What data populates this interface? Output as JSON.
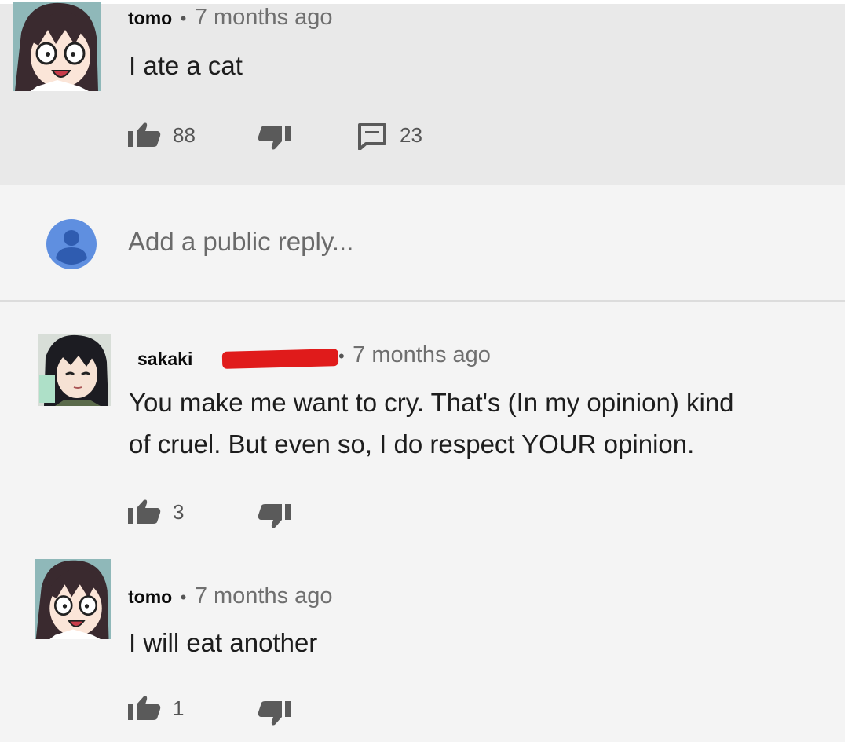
{
  "comments": [
    {
      "author": "tomo",
      "time": "7 months ago",
      "text": "I ate a cat",
      "likes": "88",
      "replies": "23"
    },
    {
      "author": "sakaki",
      "time": "7 months ago",
      "text_line1": "You make me want to cry. That's (In my opinion) kind",
      "text_line2": "of cruel. But even so, I do respect YOUR opinion.",
      "likes": "3"
    },
    {
      "author": "tomo",
      "time": "7 months ago",
      "text": "I will eat another",
      "likes": "1"
    }
  ],
  "reply": {
    "placeholder": "Add a public reply..."
  },
  "separator": "•",
  "icons": {
    "like": "thumbs-up-icon",
    "dislike": "thumbs-down-icon",
    "reply": "comment-icon",
    "user": "user-icon"
  },
  "colors": {
    "accent_blue": "#5f8fe0",
    "redaction": "#e01b1b"
  }
}
